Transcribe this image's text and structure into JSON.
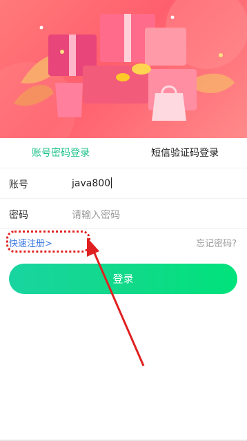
{
  "banner": {
    "description": "promotional gift boxes illustration"
  },
  "tabs": [
    {
      "label": "账号密码登录",
      "active": true
    },
    {
      "label": "短信验证码登录",
      "active": false
    }
  ],
  "form": {
    "account": {
      "label": "账号",
      "value": "java800"
    },
    "password": {
      "label": "密码",
      "placeholder": "请输入密码"
    }
  },
  "links": {
    "quick_register": "快速注册>",
    "forgot_password": "忘记密码?"
  },
  "login_button": {
    "label": "登录"
  },
  "colors": {
    "accent": "#1ec28b",
    "link": "#3a7be0",
    "annotation": "#e02020"
  }
}
